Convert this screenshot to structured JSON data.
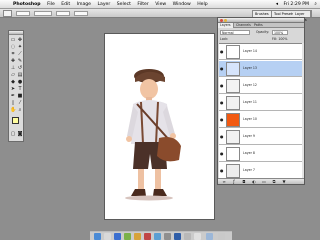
{
  "menubar": {
    "app": "Photoshop",
    "items": [
      "File",
      "Edit",
      "Image",
      "Layer",
      "Select",
      "Filter",
      "View",
      "Window",
      "Help"
    ],
    "clock": "Fri 2:29 PM"
  },
  "palette_well": {
    "tabs": [
      "Brushes",
      "Tool Presets",
      "Layer Comps"
    ]
  },
  "layers_panel": {
    "tabs": [
      "Layers",
      "Channels",
      "Paths"
    ],
    "blend_mode": "Normal",
    "opacity_label": "Opacity:",
    "opacity_value": "100%",
    "lock_label": "Lock:",
    "fill_label": "Fill: 100%",
    "layers": [
      {
        "name": "Layer 14",
        "thumb_color": "#ffffff",
        "visible": true,
        "selected": false
      },
      {
        "name": "Layer 13",
        "thumb_color": "#d6e4fb",
        "visible": true,
        "selected": true
      },
      {
        "name": "Layer 12",
        "thumb_color": "#f3f3f3",
        "visible": true,
        "selected": false
      },
      {
        "name": "Layer 11",
        "thumb_color": "#f1f1f1",
        "visible": true,
        "selected": false
      },
      {
        "name": "Layer 10",
        "thumb_color": "#f25a12",
        "visible": true,
        "selected": false
      },
      {
        "name": "Layer 9",
        "thumb_color": "#f2f2f2",
        "visible": true,
        "selected": false
      },
      {
        "name": "Layer 8",
        "thumb_color": "#ffffff",
        "visible": true,
        "selected": false
      },
      {
        "name": "Layer 7",
        "thumb_color": "#eeeeee",
        "visible": true,
        "selected": false
      }
    ]
  },
  "toolbox": {
    "foreground_color": "#fffd9e",
    "background_color": "#ffffff"
  },
  "colors": {
    "accent_selected": "#b6d0f3",
    "orange_layer": "#f25a12"
  }
}
